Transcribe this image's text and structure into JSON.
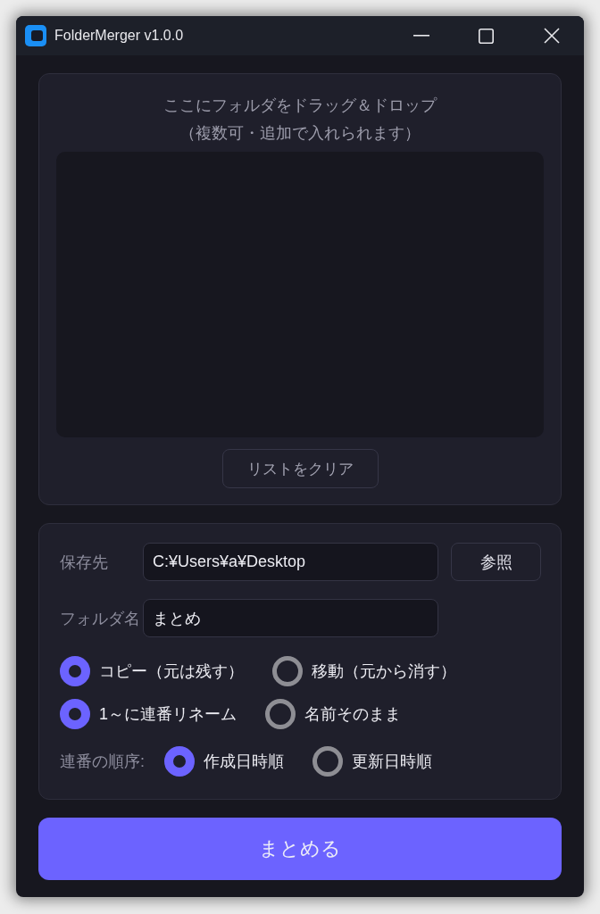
{
  "window": {
    "title": "FolderMerger v1.0.0"
  },
  "drop_panel": {
    "hint_lines": [
      "ここにフォルダをドラッグ＆ドロップ",
      "（複数可・追加で入れられます）"
    ],
    "clear_button": "リストをクリア"
  },
  "settings": {
    "fields": [
      {
        "label": "保存先",
        "value": "C:¥Users¥a¥Desktop",
        "button": "参照"
      },
      {
        "label": "フォルダ名",
        "value": "まとめ"
      }
    ],
    "radio_groups": [
      {
        "options": [
          {
            "label": "コピー（元は残す）",
            "selected": true
          },
          {
            "label": "移動（元から消す）",
            "selected": false
          }
        ]
      },
      {
        "options": [
          {
            "label": "1～に連番リネーム",
            "selected": true
          },
          {
            "label": "名前そのまま",
            "selected": false
          }
        ]
      },
      {
        "label": "連番の順序:",
        "options": [
          {
            "label": "作成日時順",
            "selected": true
          },
          {
            "label": "更新日時順",
            "selected": false
          }
        ]
      }
    ]
  },
  "action_button": "まとめる"
}
